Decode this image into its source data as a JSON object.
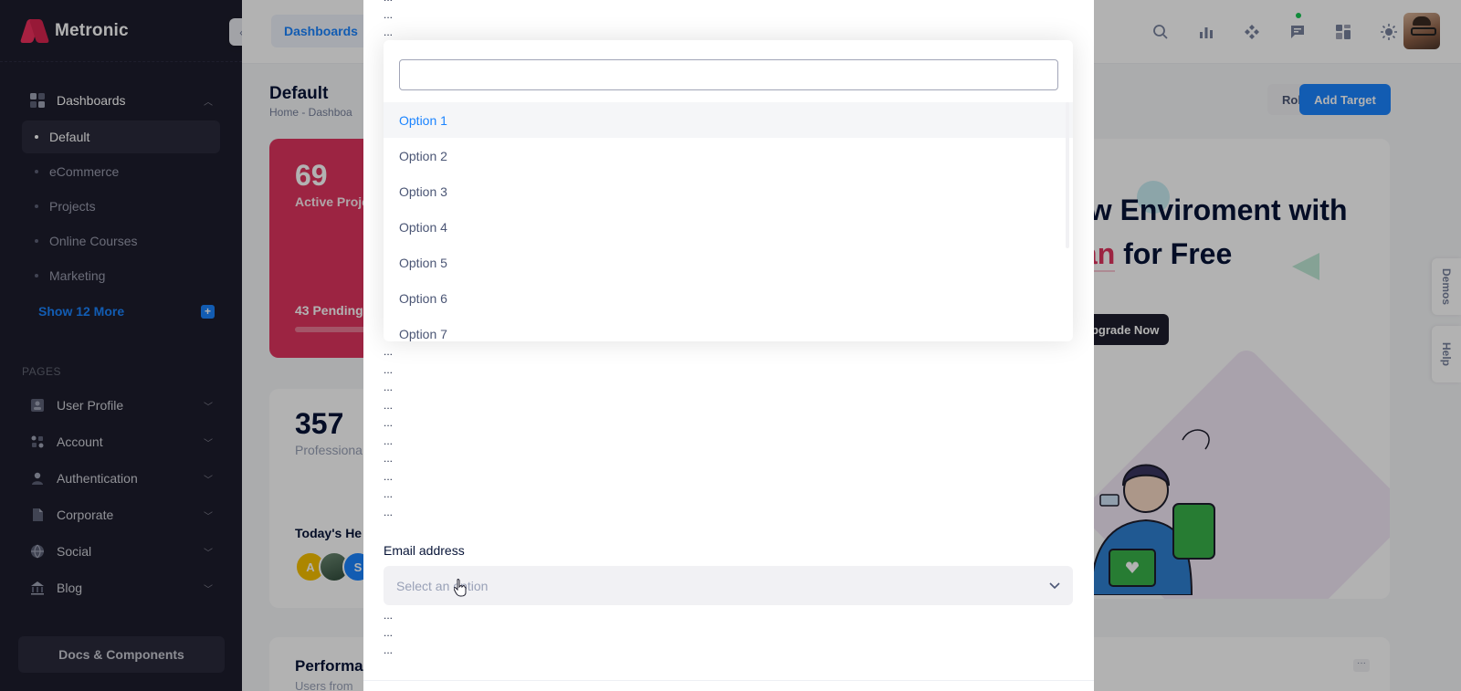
{
  "brand": {
    "name": "Metronic"
  },
  "sidebar": {
    "dashboards": {
      "label": "Dashboards",
      "items": [
        "Default",
        "eCommerce",
        "Projects",
        "Online Courses",
        "Marketing"
      ],
      "show_more": "Show 12 More",
      "plus": "+"
    },
    "section_title": "PAGES",
    "pages": [
      "User Profile",
      "Account",
      "Authentication",
      "Corporate",
      "Social",
      "Blog"
    ],
    "footer_button": "Docs & Components"
  },
  "header": {
    "breadcrumb_pill": "Dashboards",
    "icons": [
      "search-icon",
      "chart-icon",
      "apps-icon",
      "chat-icon",
      "layout-icon",
      "sun-icon"
    ]
  },
  "main": {
    "page_title": "Default",
    "crumb": "Home  -  Dashboa",
    "rollover_label": "Rollover",
    "add_target_label": "Add Target",
    "card_red": {
      "value": "69",
      "label": "Active Proje",
      "pending": "43 Pending"
    },
    "card_white": {
      "value": "357",
      "label": "Professiona",
      "today": "Today's He",
      "avatars": [
        "A",
        "",
        "S"
      ]
    },
    "performance": {
      "title": "Performa",
      "subtitle": "Users from"
    },
    "promo": {
      "line1": "ew Enviroment with",
      "line2_highlight": "lan",
      "line2_rest": " for Free",
      "button": "Upgrade Now"
    },
    "side_tabs": [
      "Demos",
      "Help"
    ]
  },
  "modal": {
    "ellipsis": "...",
    "dropdown": {
      "search_value": "",
      "options": [
        "Option 1",
        "Option 2",
        "Option 3",
        "Option 4",
        "Option 5",
        "Option 6",
        "Option 7"
      ],
      "active_index": 0
    },
    "email_label": "Email address",
    "select_placeholder": "Select an option"
  },
  "colors": {
    "accent": "#1b84ff",
    "sidebar_bg": "#1e1e2d",
    "brand_red": "#e0345f"
  }
}
